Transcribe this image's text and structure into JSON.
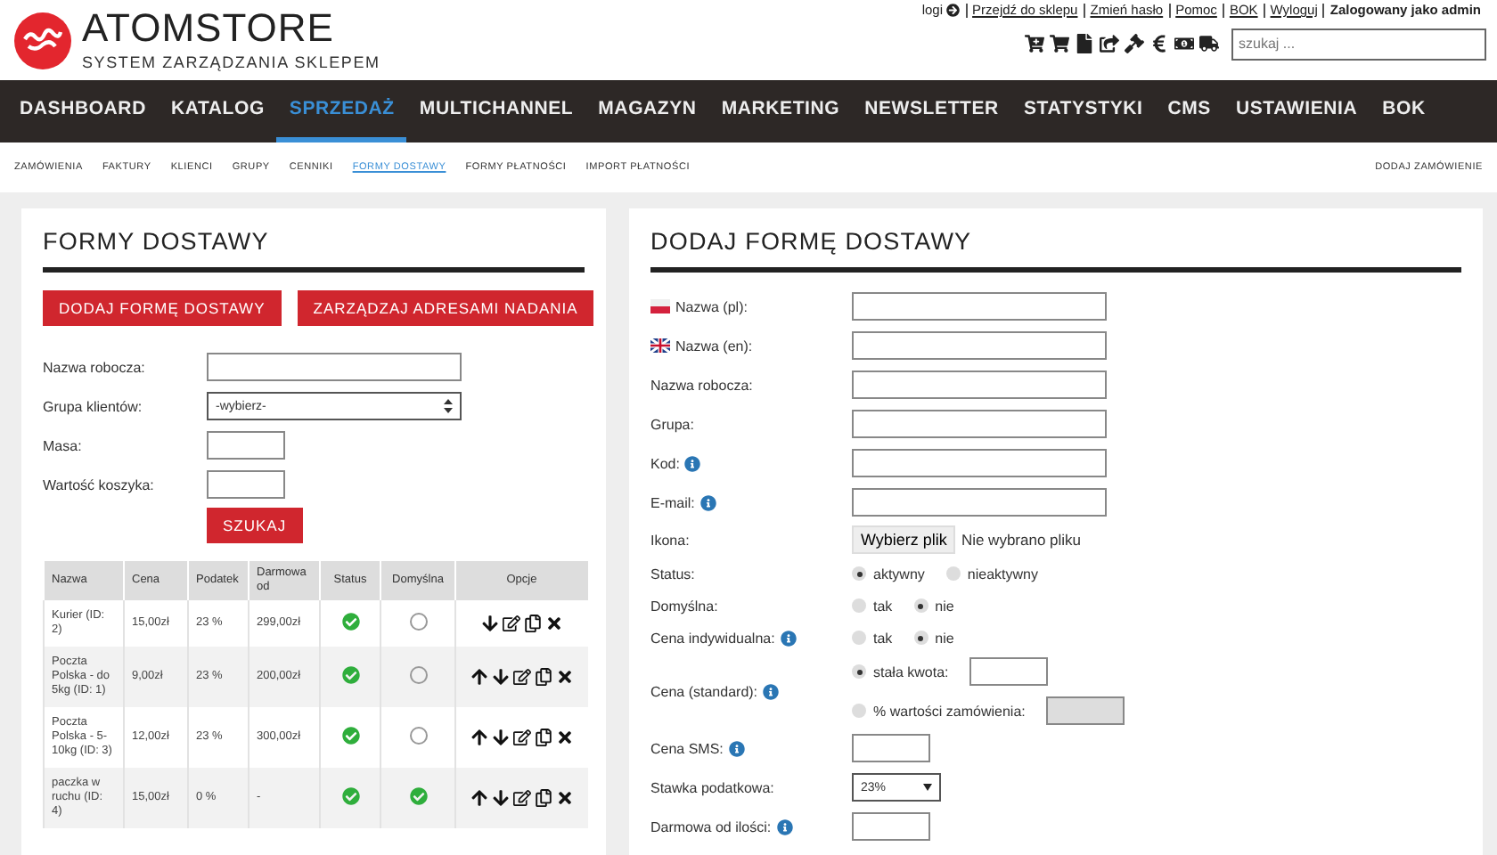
{
  "header": {
    "logo_text": "ATOMSTORE",
    "tagline": "SYSTEM ZARZĄDZANIA SKLEPEM",
    "top_links": [
      {
        "label": "logi",
        "kind": "icon_link"
      },
      {
        "label": "Przejdź do sklepu",
        "kind": "link"
      },
      {
        "label": "Zmień hasło",
        "kind": "link"
      },
      {
        "label": "Pomoc",
        "kind": "link"
      },
      {
        "label": "BOK",
        "kind": "link"
      },
      {
        "label": "Wyloguj",
        "kind": "link"
      },
      {
        "label": "Zalogowany jako admin",
        "kind": "text"
      }
    ],
    "search": {
      "placeholder": "szukaj ..."
    }
  },
  "nav": [
    {
      "label": "DASHBOARD",
      "selected": false
    },
    {
      "label": "KATALOG",
      "selected": false
    },
    {
      "label": "SPRZEDAŻ",
      "selected": true
    },
    {
      "label": "MULTICHANNEL",
      "selected": false
    },
    {
      "label": "MAGAZYN",
      "selected": false
    },
    {
      "label": "MARKETING",
      "selected": false
    },
    {
      "label": "NEWSLETTER",
      "selected": false
    },
    {
      "label": "STATYSTYKI",
      "selected": false
    },
    {
      "label": "CMS",
      "selected": false
    },
    {
      "label": "USTAWIENIA",
      "selected": false
    },
    {
      "label": "BOK",
      "selected": false
    }
  ],
  "subnav": {
    "items": [
      {
        "label": "ZAMÓWIENIA",
        "selected": false
      },
      {
        "label": "FAKTURY",
        "selected": false
      },
      {
        "label": "KLIENCI",
        "selected": false
      },
      {
        "label": "GRUPY",
        "selected": false
      },
      {
        "label": "CENNIKI",
        "selected": false
      },
      {
        "label": "FORMY DOSTAWY",
        "selected": true
      },
      {
        "label": "FORMY PŁATNOŚCI",
        "selected": false
      },
      {
        "label": "IMPORT PŁATNOŚCI",
        "selected": false
      }
    ],
    "action": "DODAJ ZAMÓWIENIE"
  },
  "list_panel": {
    "title": "FORMY DOSTAWY",
    "buttons": [
      "DODAJ FORMĘ DOSTAWY",
      "ZARZĄDZAJ ADRESAMI NADANIA"
    ],
    "filters": [
      {
        "label": "Nazwa robocza:",
        "kind": "text"
      },
      {
        "label": "Grupa klientów:",
        "kind": "select",
        "value": "-wybierz-"
      },
      {
        "label": "Masa:",
        "kind": "short"
      },
      {
        "label": "Wartość koszyka:",
        "kind": "short"
      }
    ],
    "search_button": "SZUKAJ",
    "table": {
      "columns": [
        "Nazwa",
        "Cena",
        "Podatek",
        "Darmowa od",
        "Status",
        "Domyślna",
        "Opcje"
      ],
      "rows": [
        {
          "name": "Kurier (ID: 2)",
          "price": "15,00zł",
          "tax": "23 %",
          "free_from": "299,00zł",
          "active": true,
          "default": false,
          "can_move_up": false
        },
        {
          "name": "Poczta Polska - do 5kg (ID: 1)",
          "price": "9,00zł",
          "tax": "23 %",
          "free_from": "200,00zł",
          "active": true,
          "default": false,
          "can_move_up": true
        },
        {
          "name": "Poczta Polska - 5-10kg (ID: 3)",
          "price": "12,00zł",
          "tax": "23 %",
          "free_from": "300,00zł",
          "active": true,
          "default": false,
          "can_move_up": true
        },
        {
          "name": "paczka w ruchu (ID: 4)",
          "price": "15,00zł",
          "tax": "0 %",
          "free_from": "-",
          "active": true,
          "default": true,
          "can_move_up": true
        }
      ]
    }
  },
  "form_panel": {
    "title": "DODAJ FORMĘ DOSTAWY",
    "fields": [
      {
        "kind": "text_pl",
        "label": "Nazwa (pl):",
        "info": false
      },
      {
        "kind": "text_en",
        "label": "Nazwa (en):",
        "info": false
      },
      {
        "kind": "text",
        "label": "Nazwa robocza:",
        "info": false
      },
      {
        "kind": "text",
        "label": "Grupa:",
        "info": false
      },
      {
        "kind": "text",
        "label": "Kod:",
        "info": true
      },
      {
        "kind": "text",
        "label": "E-mail:",
        "info": true
      },
      {
        "kind": "file",
        "label": "Ikona:",
        "info": false,
        "button": "Wybierz plik",
        "note": "Nie wybrano pliku"
      },
      {
        "kind": "radio",
        "label": "Status:",
        "info": false,
        "options": [
          {
            "label": "aktywny",
            "selected": true
          },
          {
            "label": "nieaktywny",
            "selected": false
          }
        ]
      },
      {
        "kind": "radio",
        "label": "Domyślna:",
        "info": false,
        "options": [
          {
            "label": "tak",
            "selected": false
          },
          {
            "label": "nie",
            "selected": true
          }
        ]
      },
      {
        "kind": "radio",
        "label": "Cena indywidualna:",
        "info": true,
        "options": [
          {
            "label": "tak",
            "selected": false
          },
          {
            "label": "nie",
            "selected": true
          }
        ]
      },
      {
        "kind": "price",
        "label": "Cena (standard):",
        "info": true,
        "options": [
          {
            "label": "stała kwota:",
            "selected": true,
            "disabled": false
          },
          {
            "label": "% wartości zamówienia:",
            "selected": false,
            "disabled": true
          }
        ]
      },
      {
        "kind": "short",
        "label": "Cena SMS:",
        "info": true
      },
      {
        "kind": "select",
        "label": "Stawka podatkowa:",
        "info": false,
        "value": "23%"
      },
      {
        "kind": "short",
        "label": "Darmowa od ilości:",
        "info": true
      }
    ]
  }
}
